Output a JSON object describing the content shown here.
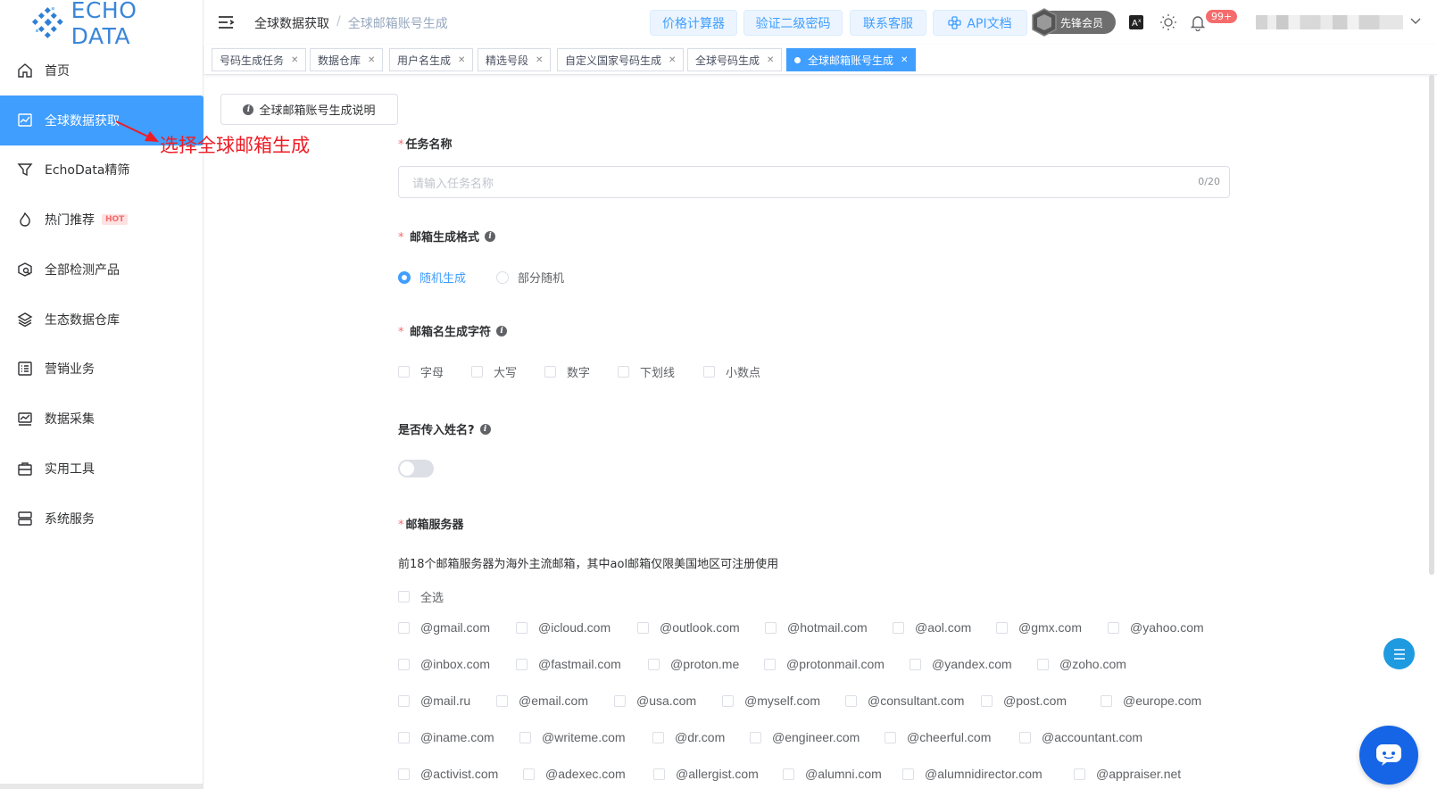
{
  "logo": {
    "text": "ECHO DATA"
  },
  "sidebar": {
    "items": [
      {
        "label": "首页",
        "icon": "home-icon"
      },
      {
        "label": "全球数据获取",
        "icon": "chart-monitor-icon",
        "active": true
      },
      {
        "label": "EchoData精筛",
        "icon": "filter-icon"
      },
      {
        "label": "热门推荐",
        "icon": "fire-icon",
        "badge": "HOT"
      },
      {
        "label": "全部检测产品",
        "icon": "search-box-icon"
      },
      {
        "label": "生态数据仓库",
        "icon": "layers-icon"
      },
      {
        "label": "营销业务",
        "icon": "list-icon"
      },
      {
        "label": "数据采集",
        "icon": "collect-icon"
      },
      {
        "label": "实用工具",
        "icon": "briefcase-icon"
      },
      {
        "label": "系统服务",
        "icon": "server-icon"
      }
    ]
  },
  "header": {
    "breadcrumb": [
      "全球数据获取",
      "全球邮箱账号生成"
    ],
    "buttons": [
      "价格计算器",
      "验证二级密码",
      "联系客服",
      "API文档"
    ],
    "vip_label": "先锋会员",
    "notification_count": "99+"
  },
  "tabs": [
    {
      "label": "号码生成任务"
    },
    {
      "label": "数据仓库"
    },
    {
      "label": "用户名生成"
    },
    {
      "label": "精选号段"
    },
    {
      "label": "自定义国家号码生成"
    },
    {
      "label": "全球号码生成"
    },
    {
      "label": "全球邮箱账号生成",
      "active": true
    }
  ],
  "main": {
    "help_button": "全球邮箱账号生成说明",
    "annotation": "选择全球邮箱生成",
    "task_name": {
      "label": "任务名称",
      "placeholder": "请输入任务名称",
      "counter": "0/20"
    },
    "format": {
      "label": "邮箱生成格式",
      "options": [
        "随机生成",
        "部分随机"
      ],
      "selected": "随机生成"
    },
    "chars": {
      "label": "邮箱名生成字符",
      "options": [
        "字母",
        "大写",
        "数字",
        "下划线",
        "小数点"
      ]
    },
    "name_toggle": {
      "label": "是否传入姓名?"
    },
    "servers": {
      "label": "邮箱服务器",
      "note": "前18个邮箱服务器为海外主流邮箱，其中aol邮箱仅限美国地区可注册使用",
      "select_all": "全选",
      "rows": [
        [
          "@gmail.com",
          "@icloud.com",
          "@outlook.com",
          "@hotmail.com",
          "@aol.com",
          "@gmx.com",
          "@yahoo.com"
        ],
        [
          "@inbox.com",
          "@fastmail.com",
          "@proton.me",
          "@protonmail.com",
          "@yandex.com",
          "@zoho.com"
        ],
        [
          "@mail.ru",
          "@email.com",
          "@usa.com",
          "@myself.com",
          "@consultant.com",
          "@post.com",
          "@europe.com"
        ],
        [
          "@iname.com",
          "@writeme.com",
          "@dr.com",
          "@engineer.com",
          "@cheerful.com",
          "@accountant.com"
        ],
        [
          "@activist.com",
          "@adexec.com",
          "@allergist.com",
          "@alumni.com",
          "@alumnidirector.com",
          "@appraiser.net"
        ]
      ]
    }
  },
  "colors": {
    "primary": "#409eff",
    "danger": "#f56c6c",
    "annotation": "#ee1c25",
    "chat": "#1565e6"
  }
}
